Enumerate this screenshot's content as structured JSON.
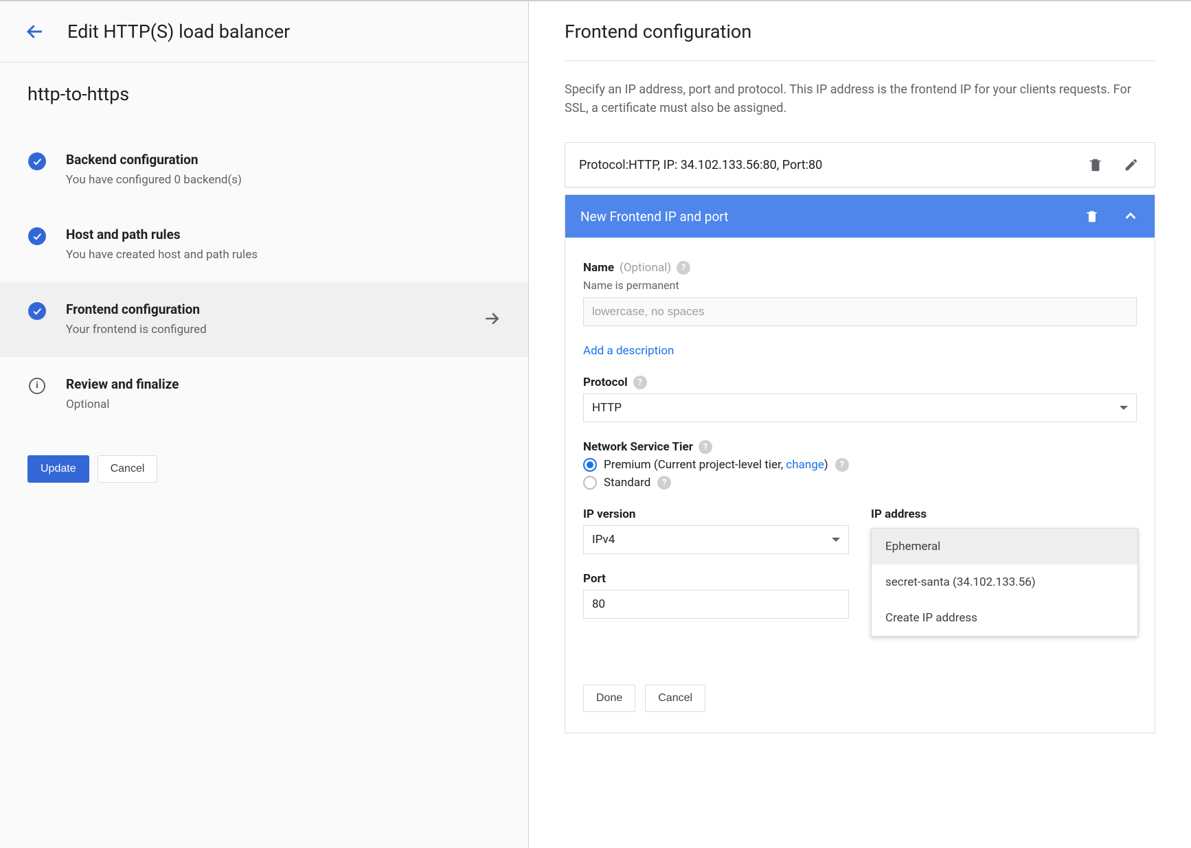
{
  "left": {
    "title": "Edit HTTP(S) load balancer",
    "lb_name": "http-to-https",
    "steps": [
      {
        "title": "Backend configuration",
        "subtitle": "You have configured 0 backend(s)",
        "icon": "check",
        "active": false
      },
      {
        "title": "Host and path rules",
        "subtitle": "You have created host and path rules",
        "icon": "check",
        "active": false
      },
      {
        "title": "Frontend configuration",
        "subtitle": "Your frontend is configured",
        "icon": "check",
        "active": true
      },
      {
        "title": "Review and finalize",
        "subtitle": "Optional",
        "icon": "info",
        "active": false
      }
    ],
    "update_label": "Update",
    "cancel_label": "Cancel"
  },
  "right": {
    "title": "Frontend configuration",
    "description": "Specify an IP address, port and protocol. This IP address is the frontend IP for your clients requests. For SSL, a certificate must also be assigned.",
    "existing_row": "Protocol:HTTP, IP: 34.102.133.56:80, Port:80",
    "expand_header": "New Frontend IP and port",
    "form": {
      "name_label": "Name",
      "name_optional": "(Optional)",
      "name_hint": "Name is permanent",
      "name_placeholder": "lowercase, no spaces",
      "add_description": "Add a description",
      "protocol_label": "Protocol",
      "protocol_value": "HTTP",
      "tier_label": "Network Service Tier",
      "tier_premium": "Premium (Current project-level tier, ",
      "tier_change": "change",
      "tier_premium_close": ")",
      "tier_standard": "Standard",
      "ip_version_label": "IP version",
      "ip_version_value": "IPv4",
      "ip_address_label": "IP address",
      "ip_dropdown": [
        "Ephemeral",
        "secret-santa (34.102.133.56)",
        "Create IP address"
      ],
      "port_label": "Port",
      "port_value": "80",
      "done_label": "Done",
      "cancel_label": "Cancel"
    }
  }
}
